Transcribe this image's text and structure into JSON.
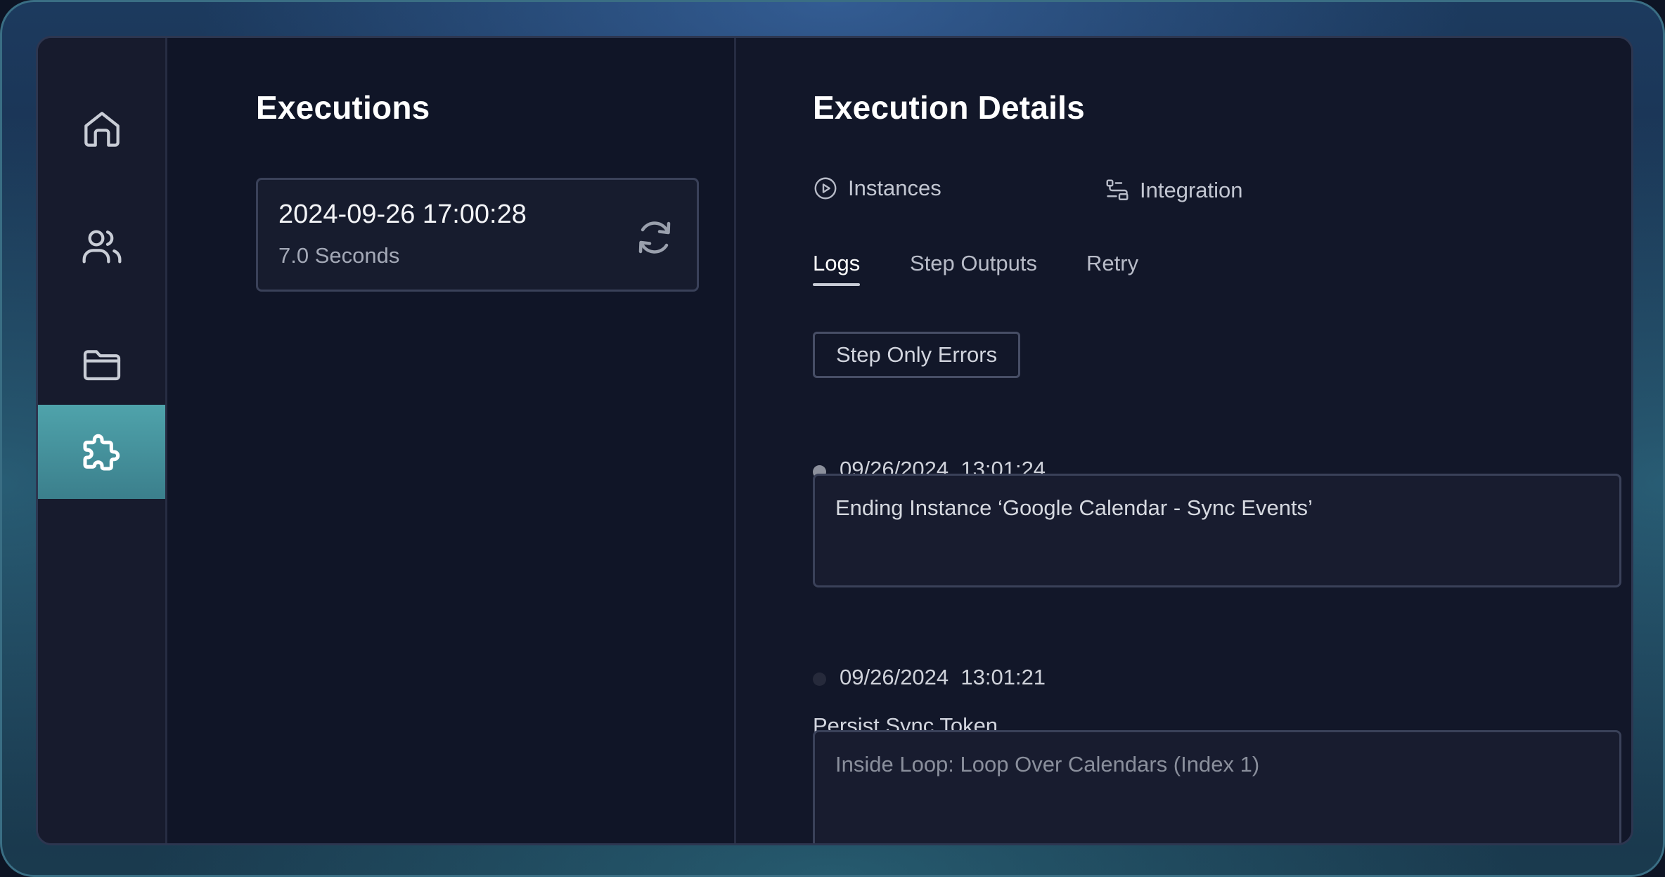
{
  "sidebar": {
    "items": [
      {
        "icon": "home-icon"
      },
      {
        "icon": "users-icon"
      },
      {
        "icon": "folder-icon"
      },
      {
        "icon": "puzzle-icon",
        "active": true
      }
    ]
  },
  "executions": {
    "title": "Executions",
    "items": [
      {
        "date": "2024-09-26 17:00:28",
        "duration": "7.0 Seconds",
        "icon": "refresh-icon"
      }
    ]
  },
  "details": {
    "title": "Execution Details",
    "instances_label": "Instances",
    "integration_label": "Integration",
    "tabs": [
      {
        "label": "Logs",
        "active": true
      },
      {
        "label": "Step Outputs",
        "active": false
      },
      {
        "label": "Retry",
        "active": false
      }
    ],
    "filter_button_label": "Step Only Errors",
    "logs": [
      {
        "date": "09/26/2024",
        "time": "13:01:24",
        "timestamp": "09/26/2024  13:01:24",
        "dot_color": "#8c909c",
        "message": "Ending Instance ‘Google Calendar - Sync Events’"
      },
      {
        "date": "09/26/2024",
        "time": "13:01:21",
        "timestamp": "09/26/2024  13:01:21",
        "dot_color": "#262a3b",
        "step": "Persist Sync Token",
        "message": "Inside Loop: Loop Over Calendars (Index 1)"
      }
    ]
  },
  "colors": {
    "accent": "#4fa3ab",
    "background": "#111628",
    "sidebar": "#171b2d",
    "border": "#3a4159"
  }
}
